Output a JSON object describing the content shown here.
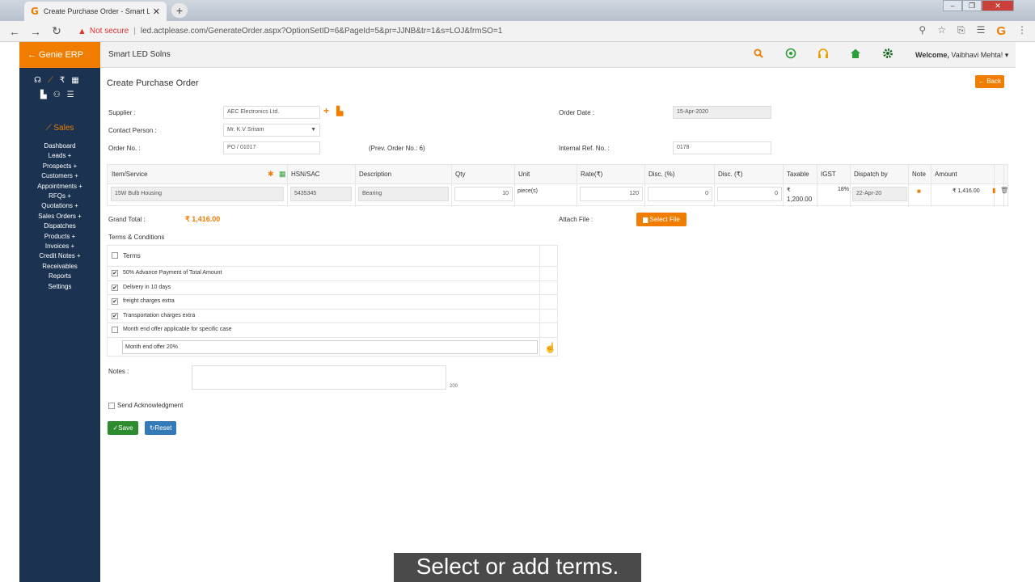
{
  "browser": {
    "tab_title": "Create Purchase Order - Smart L",
    "new_tab": "+",
    "not_secure": "Not secure",
    "url": "led.actplease.com/GenerateOrder.aspx?OptionSetID=6&PageId=5&pr=JJNB&tr=1&s=LOJ&frmSO=1"
  },
  "app": {
    "brand": "← Genie ERP",
    "company": "Smart LED Solns",
    "welcome_prefix": "Welcome,",
    "welcome_user": "Vaibhavi Mehta!",
    "accent_color": "#f07c00",
    "sidebar_color": "#1b3350"
  },
  "sidebar": {
    "section": "Sales",
    "items": [
      "Dashboard",
      "Leads +",
      "Prospects +",
      "Customers +",
      "Appointments +",
      "RFQs +",
      "Quotations +",
      "Sales Orders +",
      "Dispatches",
      "Products +",
      "Invoices +",
      "Credit Notes +",
      "Receivables",
      "Reports",
      "Settings"
    ]
  },
  "page": {
    "title": "Create Purchase Order",
    "back": "← Back"
  },
  "form": {
    "supplier_label": "Supplier :",
    "supplier_value": "AEC Electronics Ltd.",
    "contact_label": "Contact Person :",
    "contact_value": "Mr. K V Sriram",
    "order_no_label": "Order No. :",
    "order_no_value": "PO / 01017",
    "prev_order": "(Prev. Order No.: 6)",
    "order_date_label": "Order Date :",
    "order_date_value": "15-Apr-2020",
    "internal_ref_label": "Internal Ref. No. :",
    "internal_ref_value": "0178"
  },
  "items": {
    "headers": {
      "item": "Item/Service",
      "hsn": "HSN/SAC",
      "desc": "Description",
      "qty": "Qty",
      "unit": "Unit",
      "rate": "Rate(₹)",
      "disc_pct": "Disc. (%)",
      "disc_amt": "Disc. (₹)",
      "taxable": "Taxable",
      "igst": "IGST",
      "dispatch": "Dispatch by",
      "note": "Note",
      "amount": "Amount"
    },
    "row": {
      "item": "15W Bulb Housing",
      "hsn": "5435345",
      "desc": "Bearing",
      "qty": "10",
      "unit": "piece(s)",
      "rate": "120",
      "disc_pct": "0",
      "disc_amt": "0",
      "taxable_symbol": "₹",
      "taxable_value": "1,200.00",
      "igst": "18%",
      "dispatch": "22-Apr-20",
      "amount": "₹ 1,416.00"
    }
  },
  "totals": {
    "grand_label": "Grand Total :",
    "grand_value": "₹ 1,416.00",
    "attach_label": "Attach File :",
    "select_file": "Select File"
  },
  "terms": {
    "section_label": "Terms & Conditions",
    "header": "Terms",
    "rows": [
      {
        "text": "50% Advance Payment of Total Amount",
        "checked": true
      },
      {
        "text": "Delivery in 10 days",
        "checked": true
      },
      {
        "text": "freight charges extra",
        "checked": true
      },
      {
        "text": "Transportation charges extra",
        "checked": true
      },
      {
        "text": "Month end offer applicable for specific case",
        "checked": false
      }
    ],
    "new_term_value": "Month end offer 20%"
  },
  "notes": {
    "label": "Notes :",
    "char_limit": "200"
  },
  "ack": {
    "label": "Send Acknowledgment"
  },
  "actions": {
    "save": "✓Save",
    "reset": "Reset"
  },
  "caption": "Select or add terms."
}
